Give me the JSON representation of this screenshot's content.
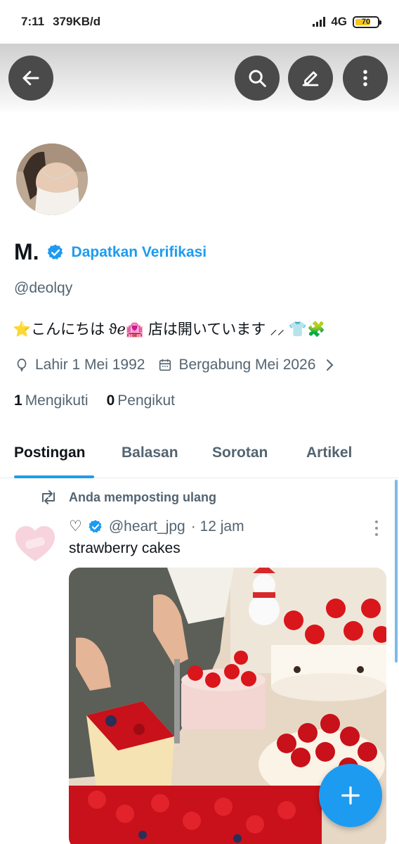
{
  "status_bar": {
    "time": "7:11",
    "speed": "379KB/d",
    "network": "4G",
    "battery": "70",
    "battery_level": 0.7
  },
  "header": {
    "back_icon": "arrow-left-icon",
    "search_icon": "search-icon",
    "edit_icon": "pencil-icon",
    "more_icon": "more-vertical-icon"
  },
  "profile": {
    "name": "M.",
    "verify_link": "Dapatkan Verifikasi",
    "handle": "@deolqy",
    "bio": "⭐こんにちは ϑℯ🏩 店は開いています ⸝⸝ 👕🧩",
    "birth": "Lahir 1 Mei 1992",
    "joined": "Bergabung Mei 2026",
    "following_count": "1",
    "following_label": "Mengikuti",
    "followers_count": "0",
    "followers_label": "Pengikut"
  },
  "tabs": [
    "Postingan",
    "Balasan",
    "Sorotan",
    "Artikel"
  ],
  "post": {
    "repost_label": "Anda memposting ulang",
    "display_name": "♡",
    "handle": "@heart_jpg",
    "time": "· 12 jam",
    "text": "strawberry cakes"
  },
  "colors": {
    "accent": "#1d9bf0",
    "text": "#0f1419",
    "muted": "#536471",
    "header_button": "#4a4a4a"
  }
}
